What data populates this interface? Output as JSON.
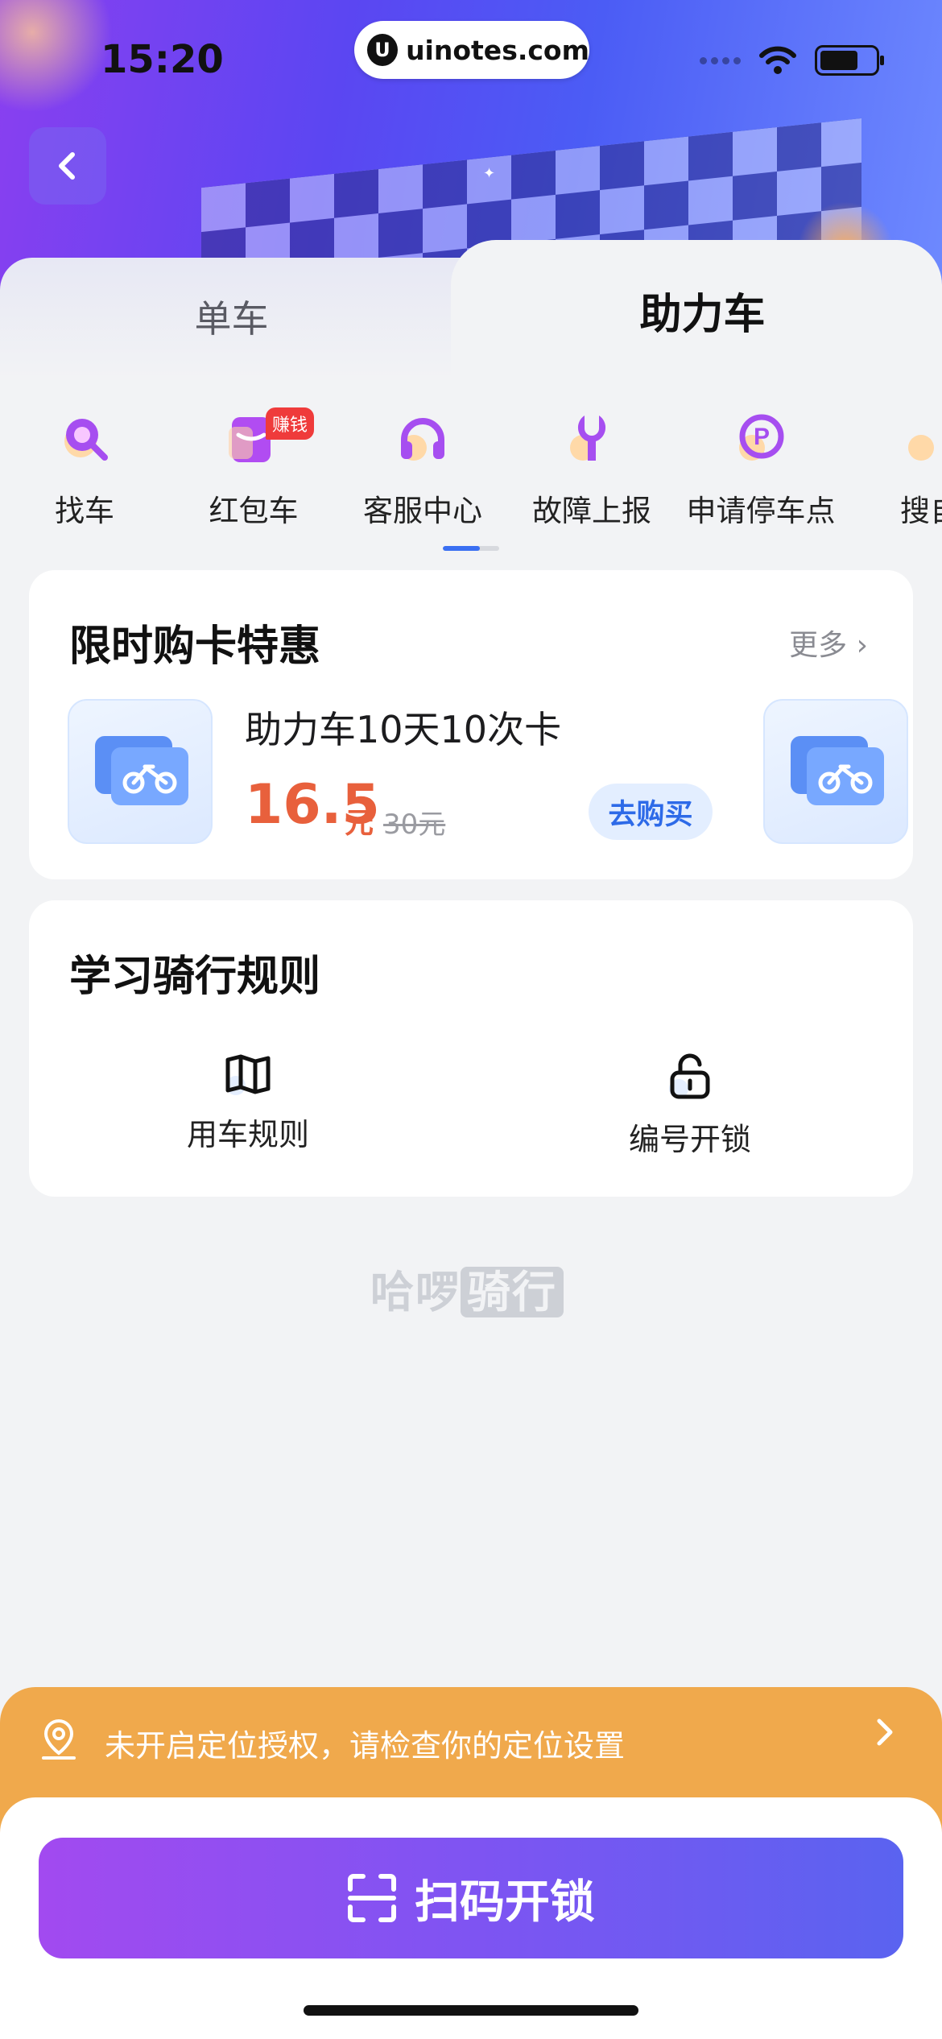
{
  "status_bar": {
    "time": "15:20",
    "url": "uinotes.com"
  },
  "tabs": [
    {
      "label": "单车",
      "active": false
    },
    {
      "label": "助力车",
      "active": true
    }
  ],
  "quick_menu": [
    {
      "label": "找车",
      "icon": "search-bike-icon"
    },
    {
      "label": "红包车",
      "icon": "red-envelope-icon",
      "badge": "赚钱"
    },
    {
      "label": "客服中心",
      "icon": "headset-icon"
    },
    {
      "label": "故障上报",
      "icon": "wrench-icon"
    },
    {
      "label": "申请停车点",
      "icon": "parking-icon"
    },
    {
      "label": "搜自",
      "icon": "partial-icon"
    }
  ],
  "promo_card": {
    "title": "限时购卡特惠",
    "more_label": "更多",
    "product": {
      "name": "助力车10天10次卡",
      "price": "16.5",
      "price_unit": "元",
      "old_price": "30元",
      "buy_label": "去购买"
    }
  },
  "rules_card": {
    "title": "学习骑行规则",
    "items": [
      {
        "label": "用车规则",
        "icon": "map-icon"
      },
      {
        "label": "编号开锁",
        "icon": "unlock-icon"
      }
    ]
  },
  "watermark": {
    "text1": "哈啰",
    "text2": "骑行"
  },
  "location_bar": {
    "text": "未开启定位授权，请检查你的定位设置"
  },
  "scan_button": {
    "label": "扫码开锁"
  },
  "colors": {
    "accent_blue": "#3a6ff2",
    "price_orange": "#e8603c",
    "location_bar": "#f0a94c",
    "scan_gradient_start": "#a24af0",
    "scan_gradient_end": "#5a63f0"
  }
}
